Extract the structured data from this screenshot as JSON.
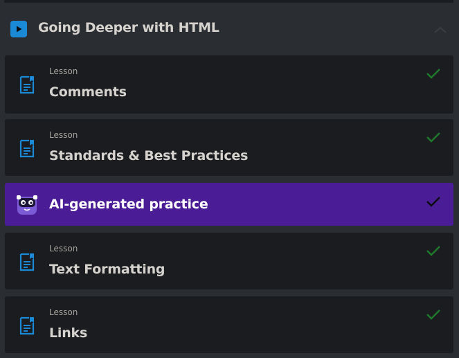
{
  "section": {
    "title": "Going Deeper with HTML"
  },
  "items": [
    {
      "tag": "Lesson",
      "title": "Comments",
      "completed": true
    },
    {
      "tag": "Lesson",
      "title": "Standards & Best Practices",
      "completed": true
    },
    {
      "tag": "",
      "title": "AI-generated practice",
      "completed": true,
      "active": true
    },
    {
      "tag": "Lesson",
      "title": "Text Formatting",
      "completed": true
    },
    {
      "tag": "Lesson",
      "title": "Links",
      "completed": true
    }
  ],
  "colors": {
    "accent_blue": "#1b8ad6",
    "check_green": "#1f7a2c",
    "active_purple": "#4a1d96",
    "card_bg": "#1b1c1f"
  }
}
